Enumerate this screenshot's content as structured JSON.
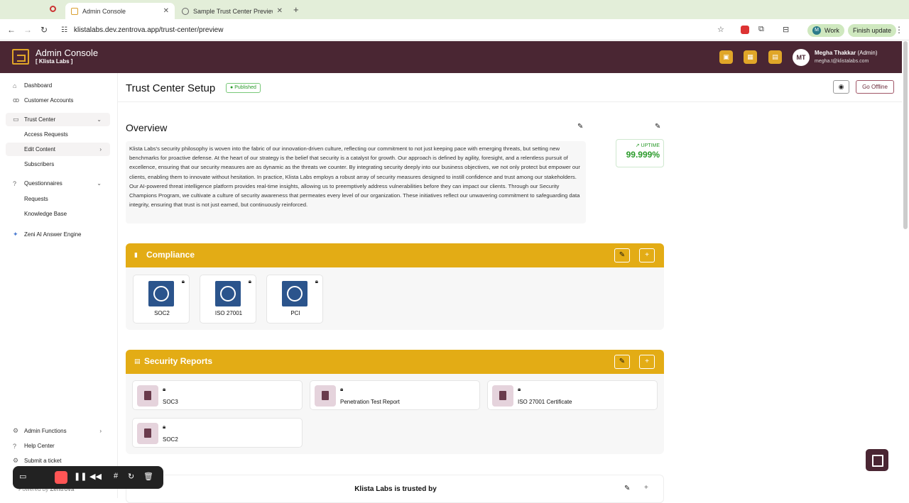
{
  "browser": {
    "tabs": [
      {
        "label": "Admin Console",
        "active": true
      },
      {
        "label": "Sample Trust Center Preview",
        "active": false
      }
    ],
    "url": "klistalabs.dev.zentrova.app/trust-center/preview",
    "profile_label": "Work",
    "update_label": "Finish update",
    "profile_initial": "M"
  },
  "header": {
    "title": "Admin Console",
    "subtitle": "[ Klista Labs ]",
    "avatar_initials": "MT",
    "user_name": "Megha Thakkar",
    "user_role": "(Admin)",
    "user_email": "megha.t@klistalabs.com",
    "accent": "#e0a628",
    "bg": "#4a2633"
  },
  "sidebar": {
    "items": [
      {
        "label": "Dashboard"
      },
      {
        "label": "Customer Accounts"
      },
      {
        "label": "Trust Center"
      },
      {
        "label": "Access Requests"
      },
      {
        "label": "Edit Content"
      },
      {
        "label": "Subscribers"
      },
      {
        "label": "Questionnaires"
      },
      {
        "label": "Requests"
      },
      {
        "label": "Knowledge Base"
      },
      {
        "label": "Zeni AI Answer Engine"
      },
      {
        "label": "Admin Functions"
      },
      {
        "label": "Help Center"
      },
      {
        "label": "Submit a ticket"
      }
    ]
  },
  "page": {
    "title": "Trust Center Setup",
    "status_badge": "Published",
    "go_offline_label": "Go Offline"
  },
  "overview": {
    "title": "Overview",
    "text": "Klista Labs's security philosophy is woven into the fabric of our innovation-driven culture, reflecting our commitment to not just keeping pace with emerging threats, but setting new benchmarks for proactive defense. At the heart of our strategy is the belief that security is a catalyst for growth. Our approach is defined by agility, foresight, and a relentless pursuit of excellence, ensuring that our security measures are as dynamic as the threats we counter. By integrating security deeply into our business objectives, we not only protect but empower our clients, enabling them to innovate without hesitation. In practice, Klista Labs employs a robust array of security measures designed to instill confidence and trust among our stakeholders. Our AI-powered threat intelligence platform provides real-time insights, allowing us to preemptively address vulnerabilities before they can impact our clients. Through our Security Champions Program, we cultivate a culture of security awareness that permeates every level of our organization. These initiatives reflect our unwavering commitment to safeguarding data integrity, ensuring that trust is not just earned, but continuously reinforced.",
    "uptime_label": "UPTIME",
    "uptime_value": "99.999%"
  },
  "compliance": {
    "title": "Compliance",
    "items": [
      {
        "name": "SOC2"
      },
      {
        "name": "ISO 27001"
      },
      {
        "name": "PCI"
      }
    ]
  },
  "security_reports": {
    "title": "Security Reports",
    "items": [
      {
        "name": "SOC3"
      },
      {
        "name": "Penetration Test Report"
      },
      {
        "name": "ISO 27001 Certificate"
      },
      {
        "name": "SOC2"
      }
    ]
  },
  "trusted_by": {
    "title": "Klista Labs is trusted by"
  },
  "footer": {
    "powered_by": "Powered by",
    "brand": "Zentrova"
  }
}
